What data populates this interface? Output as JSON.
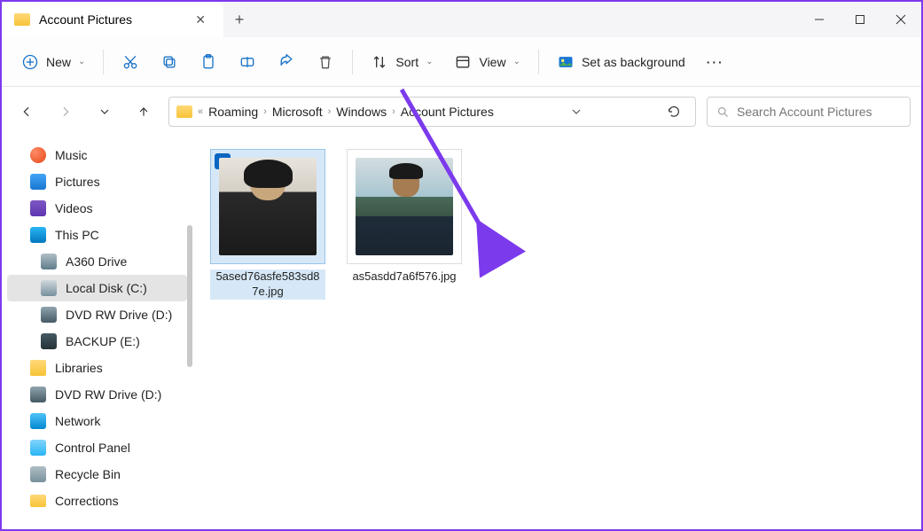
{
  "tab": {
    "title": "Account Pictures"
  },
  "toolbar": {
    "new_label": "New",
    "sort_label": "Sort",
    "view_label": "View",
    "background_label": "Set as background"
  },
  "breadcrumbs": {
    "prefix": "«",
    "items": [
      "Roaming",
      "Microsoft",
      "Windows",
      "Account Pictures"
    ]
  },
  "search": {
    "placeholder": "Search Account Pictures"
  },
  "sidebar": {
    "items": [
      {
        "label": "Music",
        "icon": "music",
        "sub": false
      },
      {
        "label": "Pictures",
        "icon": "pictures",
        "sub": false
      },
      {
        "label": "Videos",
        "icon": "videos",
        "sub": false
      },
      {
        "label": "This PC",
        "icon": "thispc",
        "sub": false
      },
      {
        "label": "A360 Drive",
        "icon": "drive",
        "sub": true
      },
      {
        "label": "Local Disk (C:)",
        "icon": "localdisk",
        "sub": true,
        "selected": true
      },
      {
        "label": "DVD RW Drive (D:)",
        "icon": "dvd",
        "sub": true
      },
      {
        "label": "BACKUP (E:)",
        "icon": "backup",
        "sub": true
      },
      {
        "label": "Libraries",
        "icon": "libraries",
        "sub": false
      },
      {
        "label": "DVD RW Drive (D:)",
        "icon": "dvd",
        "sub": false
      },
      {
        "label": "Network",
        "icon": "network",
        "sub": false
      },
      {
        "label": "Control Panel",
        "icon": "cpanel",
        "sub": false
      },
      {
        "label": "Recycle Bin",
        "icon": "recycle",
        "sub": false
      },
      {
        "label": "Corrections",
        "icon": "folder",
        "sub": false
      }
    ]
  },
  "files": [
    {
      "name": "5ased76asfe583sd87e.jpg",
      "selected": true
    },
    {
      "name": "as5asdd7a6f576.jpg",
      "selected": false
    }
  ]
}
